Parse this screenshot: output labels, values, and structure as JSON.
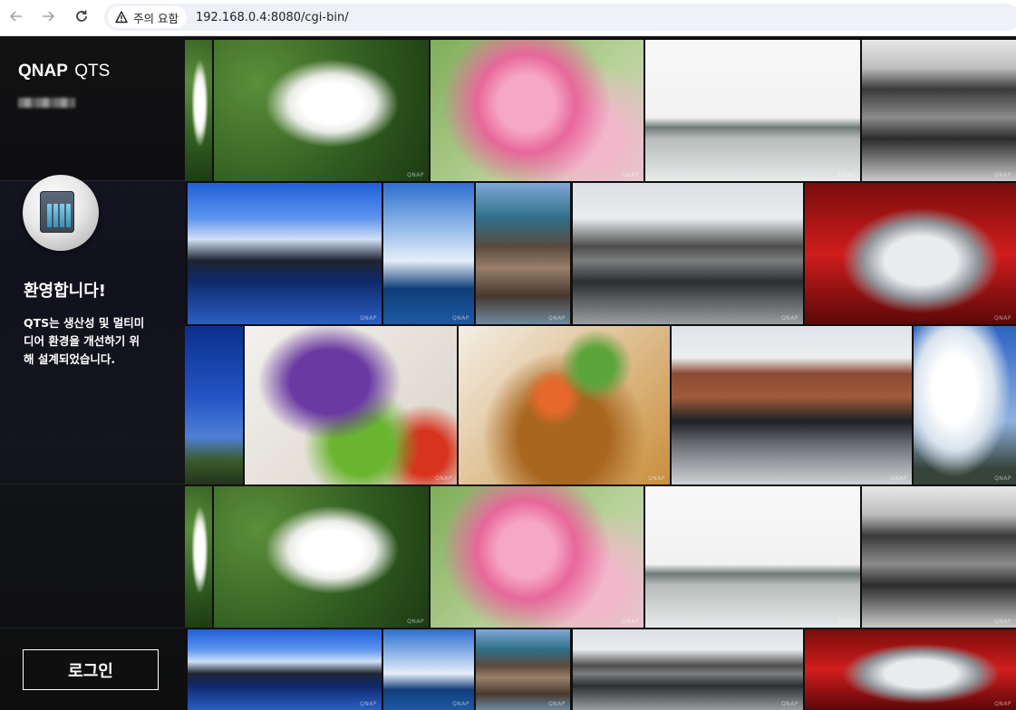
{
  "browser": {
    "back_icon": "arrow-left-icon",
    "forward_icon": "arrow-right-icon",
    "reload_icon": "reload-icon",
    "security_label": "주의 요함",
    "url": "192.168.0.4:8080/cgi-bin/"
  },
  "login_panel": {
    "brand_bold": "QNAP",
    "brand_light": "QTS",
    "welcome": "환영합니다!",
    "description_lines": [
      "QTS는 생산성 및 멀티미",
      "디어 환경을 개선하기 위",
      "해 설계되었습니다."
    ],
    "login_button": "로그인"
  },
  "wall": {
    "watermark": "QNAP",
    "photo_names": [
      "cyclamen",
      "cherry-blossom",
      "harbor-fog",
      "rocky-shore",
      "water-villa",
      "yacht-marina",
      "rock-sea",
      "canal-warehouse",
      "race-car",
      "blue-sky",
      "grilled-vegetables",
      "curry-dish",
      "canal-bridge",
      "clouds"
    ]
  }
}
